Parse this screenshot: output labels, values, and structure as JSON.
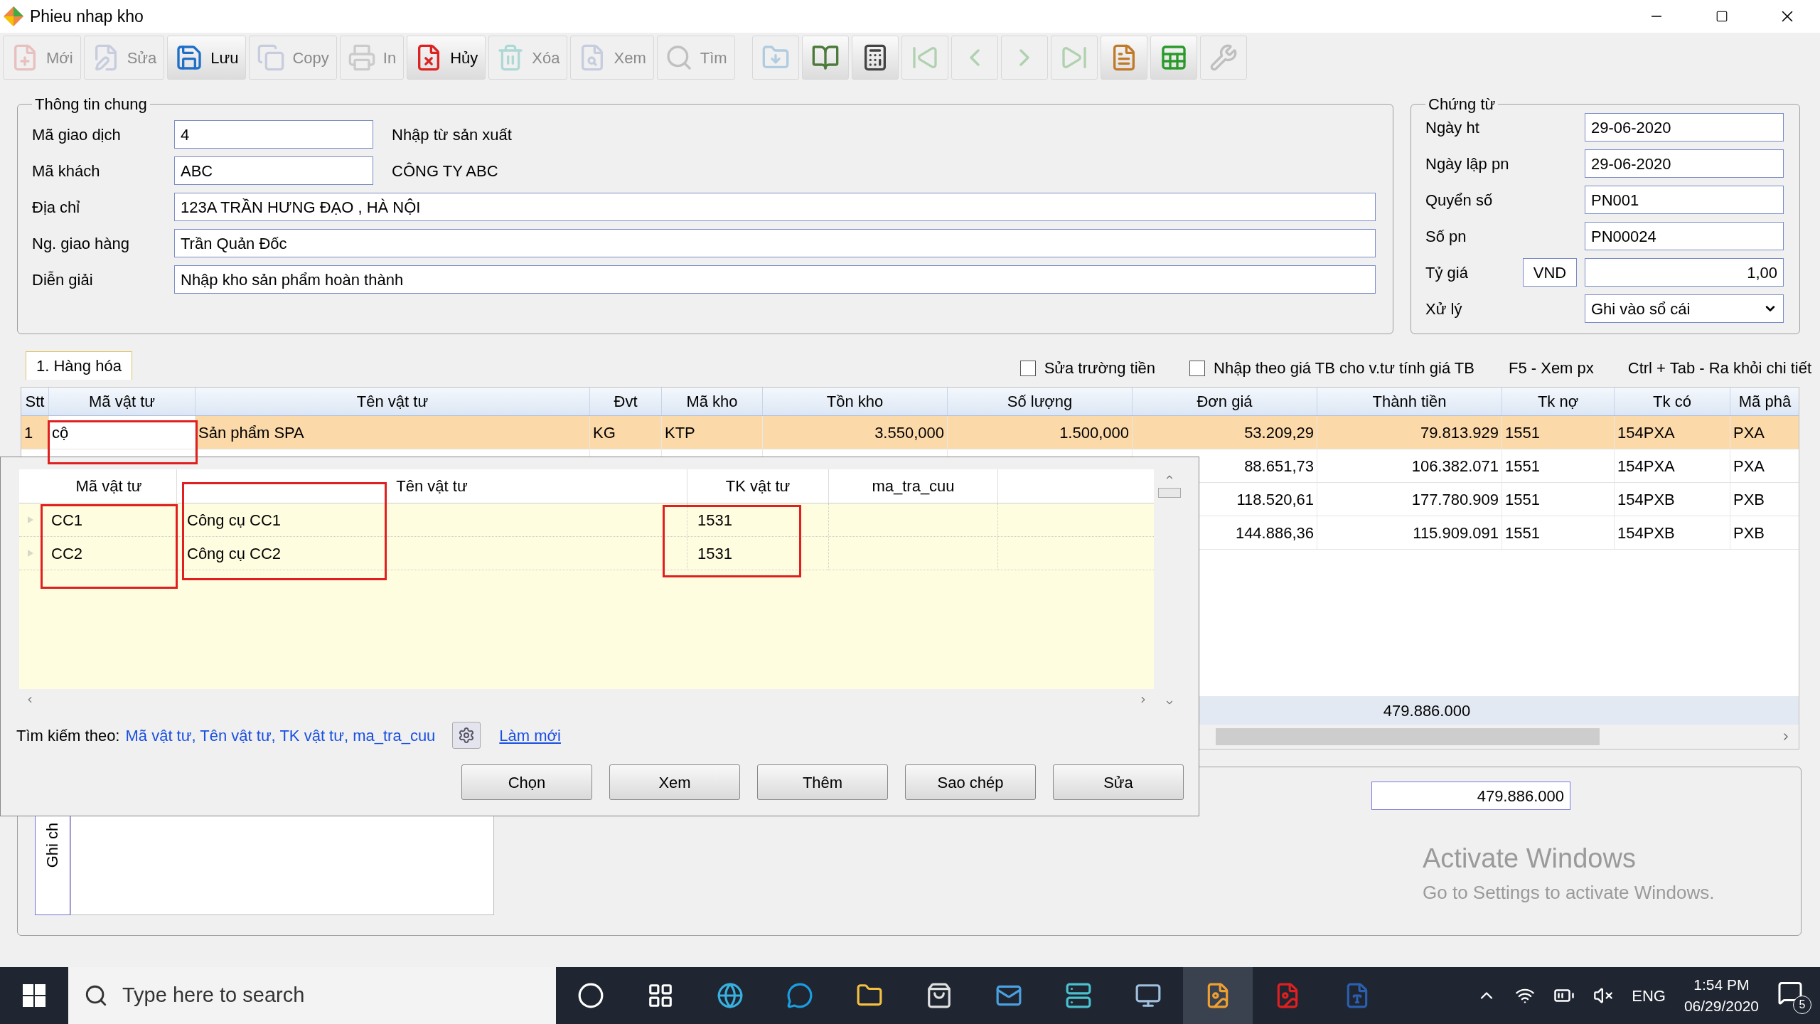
{
  "window": {
    "title": "Phieu nhap kho"
  },
  "toolbar": [
    {
      "label": "Mới",
      "disabled": true
    },
    {
      "label": "Sửa",
      "disabled": true
    },
    {
      "label": "Lưu",
      "disabled": false
    },
    {
      "label": "Copy",
      "disabled": true
    },
    {
      "label": "In",
      "disabled": true
    },
    {
      "label": "Hủy",
      "disabled": false
    },
    {
      "label": "Xóa",
      "disabled": true
    },
    {
      "label": "Xem",
      "disabled": true
    },
    {
      "label": "Tìm",
      "disabled": true
    }
  ],
  "toolbar_icons": [
    {
      "disabled": true
    },
    {
      "disabled": false
    },
    {
      "disabled": false
    },
    {
      "disabled": true
    },
    {
      "disabled": true
    },
    {
      "disabled": true
    },
    {
      "disabled": true
    },
    {
      "disabled": false
    },
    {
      "disabled": false
    },
    {
      "disabled": true
    }
  ],
  "general": {
    "title": "Thông tin chung",
    "fields": [
      {
        "label": "Mã giao dịch",
        "value": "4",
        "note": "Nhập từ sản xuất",
        "kind": "short"
      },
      {
        "label": "Mã khách",
        "value": "ABC",
        "note": "CÔNG TY ABC",
        "kind": "short"
      },
      {
        "label": "Địa chỉ",
        "value": "123A TRẦN HƯNG ĐẠO , HÀ NỘI",
        "kind": "wide"
      },
      {
        "label": "Ng. giao hàng",
        "value": "Trần Quản Đốc",
        "kind": "wide"
      },
      {
        "label": "Diễn giải",
        "value": "Nhập kho sản phẩm hoàn thành",
        "kind": "wide"
      }
    ]
  },
  "voucher": {
    "title": "Chứng từ",
    "fields": [
      {
        "label": "Ngày ht",
        "value": "29-06-2020",
        "kind": "text"
      },
      {
        "label": "Ngày lập pn",
        "value": "29-06-2020",
        "kind": "text"
      },
      {
        "label": "Quyển số",
        "value": "PN001",
        "kind": "text"
      },
      {
        "label": "Số pn",
        "value": "PN00024",
        "kind": "text"
      },
      {
        "label": "Tỷ giá",
        "currency": "VND",
        "value": "1,00",
        "kind": "rate"
      },
      {
        "label": "Xử lý",
        "value": "Ghi vào sổ cái",
        "kind": "select"
      }
    ]
  },
  "tabs": [
    {
      "label": "1. Hàng hóa",
      "selected": true
    }
  ],
  "options": [
    {
      "label": "Sửa trường tiền",
      "checked": false
    },
    {
      "label": "Nhập theo giá TB cho v.tư tính giá TB",
      "checked": false
    }
  ],
  "hints": [
    "F5 - Xem px",
    "Ctrl + Tab - Ra khỏi chi tiết"
  ],
  "table": {
    "columns": [
      "Stt",
      "Mã vật tư",
      "Tên vật tư",
      "Đvt",
      "Mã kho",
      "Tồn kho",
      "Số lượng",
      "Đơn giá",
      "Thành tiền",
      "Tk nợ",
      "Tk có",
      "Mã phâ"
    ],
    "rows": [
      {
        "selected": true,
        "cells": [
          "1",
          "cộ",
          "Sản phẩm SPA",
          "KG",
          "KTP",
          "3.550,000",
          "1.500,000",
          "53.209,29",
          "79.813.929",
          "1551",
          "154PXA",
          "PXA"
        ]
      },
      {
        "selected": false,
        "cells": [
          "",
          "",
          "",
          "",
          "",
          "",
          "",
          "88.651,73",
          "106.382.071",
          "1551",
          "154PXA",
          "PXA"
        ]
      },
      {
        "selected": false,
        "cells": [
          "",
          "",
          "",
          "",
          "",
          "",
          "",
          "118.520,61",
          "177.780.909",
          "1551",
          "154PXB",
          "PXB"
        ]
      },
      {
        "selected": false,
        "cells": [
          "",
          "",
          "",
          "",
          "",
          "",
          "",
          "144.886,36",
          "115.909.091",
          "1551",
          "154PXB",
          "PXB"
        ]
      }
    ],
    "total": "479.886.000"
  },
  "lookup": {
    "columns": [
      "Mã vật tư",
      "Tên vật tư",
      "TK vật tư",
      "ma_tra_cuu"
    ],
    "rows": [
      [
        "CC1",
        "Công cụ CC1",
        "1531",
        ""
      ],
      [
        "CC2",
        "Công cụ CC2",
        "1531",
        ""
      ]
    ],
    "search_label": "Tìm kiếm theo:",
    "search_fields": "Mã vật tư, Tên vật tư, TK vật tư, ma_tra_cuu",
    "refresh": "Làm mới",
    "buttons": [
      "Chọn",
      "Xem",
      "Thêm",
      "Sao chép",
      "Sửa"
    ]
  },
  "notes": {
    "label": "Ghi ch"
  },
  "grand_total": "479.886.000",
  "activation": {
    "title": "Activate Windows",
    "text": "Go to Settings to activate Windows."
  },
  "taskbar": {
    "search_placeholder": "Type here to search",
    "language": "ENG",
    "time": "1:54 PM",
    "date": "06/29/2020",
    "notifications": "5"
  }
}
